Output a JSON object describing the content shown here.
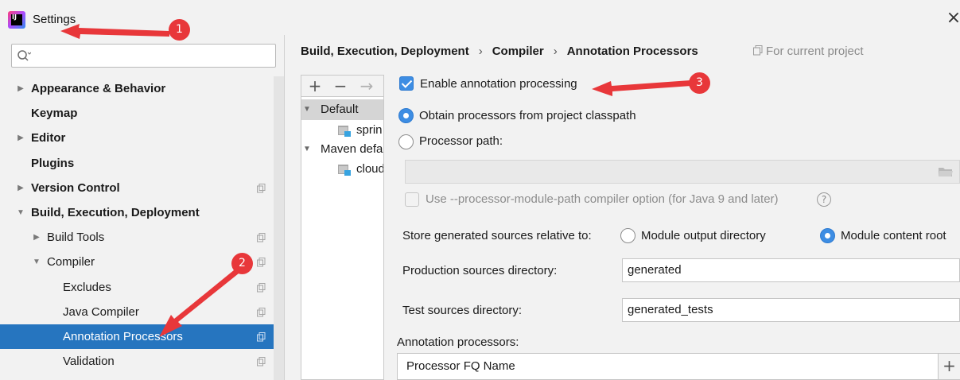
{
  "window": {
    "title": "Settings",
    "close_glyph": "×"
  },
  "search": {
    "placeholder": ""
  },
  "sidebar": {
    "items": [
      {
        "label": "Appearance & Behavior",
        "level": 0,
        "expandable": true,
        "expanded": false,
        "bold": true,
        "copy_icon": false,
        "selected": false
      },
      {
        "label": "Keymap",
        "level": 0,
        "expandable": false,
        "expanded": false,
        "bold": true,
        "copy_icon": false,
        "selected": false
      },
      {
        "label": "Editor",
        "level": 0,
        "expandable": true,
        "expanded": false,
        "bold": true,
        "copy_icon": false,
        "selected": false
      },
      {
        "label": "Plugins",
        "level": 0,
        "expandable": false,
        "expanded": false,
        "bold": true,
        "copy_icon": false,
        "selected": false
      },
      {
        "label": "Version Control",
        "level": 0,
        "expandable": true,
        "expanded": false,
        "bold": true,
        "copy_icon": true,
        "selected": false
      },
      {
        "label": "Build, Execution, Deployment",
        "level": 0,
        "expandable": true,
        "expanded": true,
        "bold": true,
        "copy_icon": false,
        "selected": false
      },
      {
        "label": "Build Tools",
        "level": 1,
        "expandable": true,
        "expanded": false,
        "bold": false,
        "copy_icon": true,
        "selected": false
      },
      {
        "label": "Compiler",
        "level": 1,
        "expandable": true,
        "expanded": true,
        "bold": false,
        "copy_icon": true,
        "selected": false
      },
      {
        "label": "Excludes",
        "level": 2,
        "expandable": false,
        "expanded": false,
        "bold": false,
        "copy_icon": true,
        "selected": false
      },
      {
        "label": "Java Compiler",
        "level": 2,
        "expandable": false,
        "expanded": false,
        "bold": false,
        "copy_icon": true,
        "selected": false
      },
      {
        "label": "Annotation Processors",
        "level": 2,
        "expandable": false,
        "expanded": false,
        "bold": false,
        "copy_icon": true,
        "selected": true
      },
      {
        "label": "Validation",
        "level": 2,
        "expandable": false,
        "expanded": false,
        "bold": false,
        "copy_icon": true,
        "selected": false
      }
    ]
  },
  "breadcrumb": {
    "items": [
      "Build, Execution, Deployment",
      "Compiler",
      "Annotation Processors"
    ],
    "separator": "›"
  },
  "scope": {
    "label": "For current project"
  },
  "profiles": {
    "toolbar": {
      "add": "+",
      "remove": "−",
      "move": "→"
    },
    "tree": [
      {
        "label": "Default",
        "expanded": true,
        "selected": true
      },
      {
        "label": "sprin",
        "module": true
      },
      {
        "label": "Maven defa",
        "expanded": true,
        "selected": false
      },
      {
        "label": "cloud",
        "module": true
      }
    ]
  },
  "options": {
    "enable_processing": {
      "label": "Enable annotation processing",
      "checked": true
    },
    "obtain_from_classpath": {
      "label": "Obtain processors from project classpath",
      "selected": true
    },
    "processor_path": {
      "label": "Processor path:",
      "selected": false,
      "value": ""
    },
    "module_path_option": {
      "label": "Use --processor-module-path compiler option (for Java 9 and later)",
      "checked": false,
      "disabled": true,
      "help_glyph": "?"
    },
    "store_relative": {
      "label": "Store generated sources relative to:",
      "choices": [
        {
          "label": "Module output directory",
          "selected": false
        },
        {
          "label": "Module content root",
          "selected": true
        }
      ]
    },
    "production_dir": {
      "label": "Production sources directory:",
      "value": "generated"
    },
    "test_dir": {
      "label": "Test sources directory:",
      "value": "generated_tests"
    }
  },
  "processors_table": {
    "title": "Annotation processors:",
    "column": "Processor FQ Name",
    "add_glyph": "+"
  },
  "annotations": [
    {
      "number": "1"
    },
    {
      "number": "2"
    },
    {
      "number": "3"
    }
  ],
  "colors": {
    "selection": "#2675bf",
    "accent": "#3d8de3",
    "callout": "#e8373a"
  }
}
